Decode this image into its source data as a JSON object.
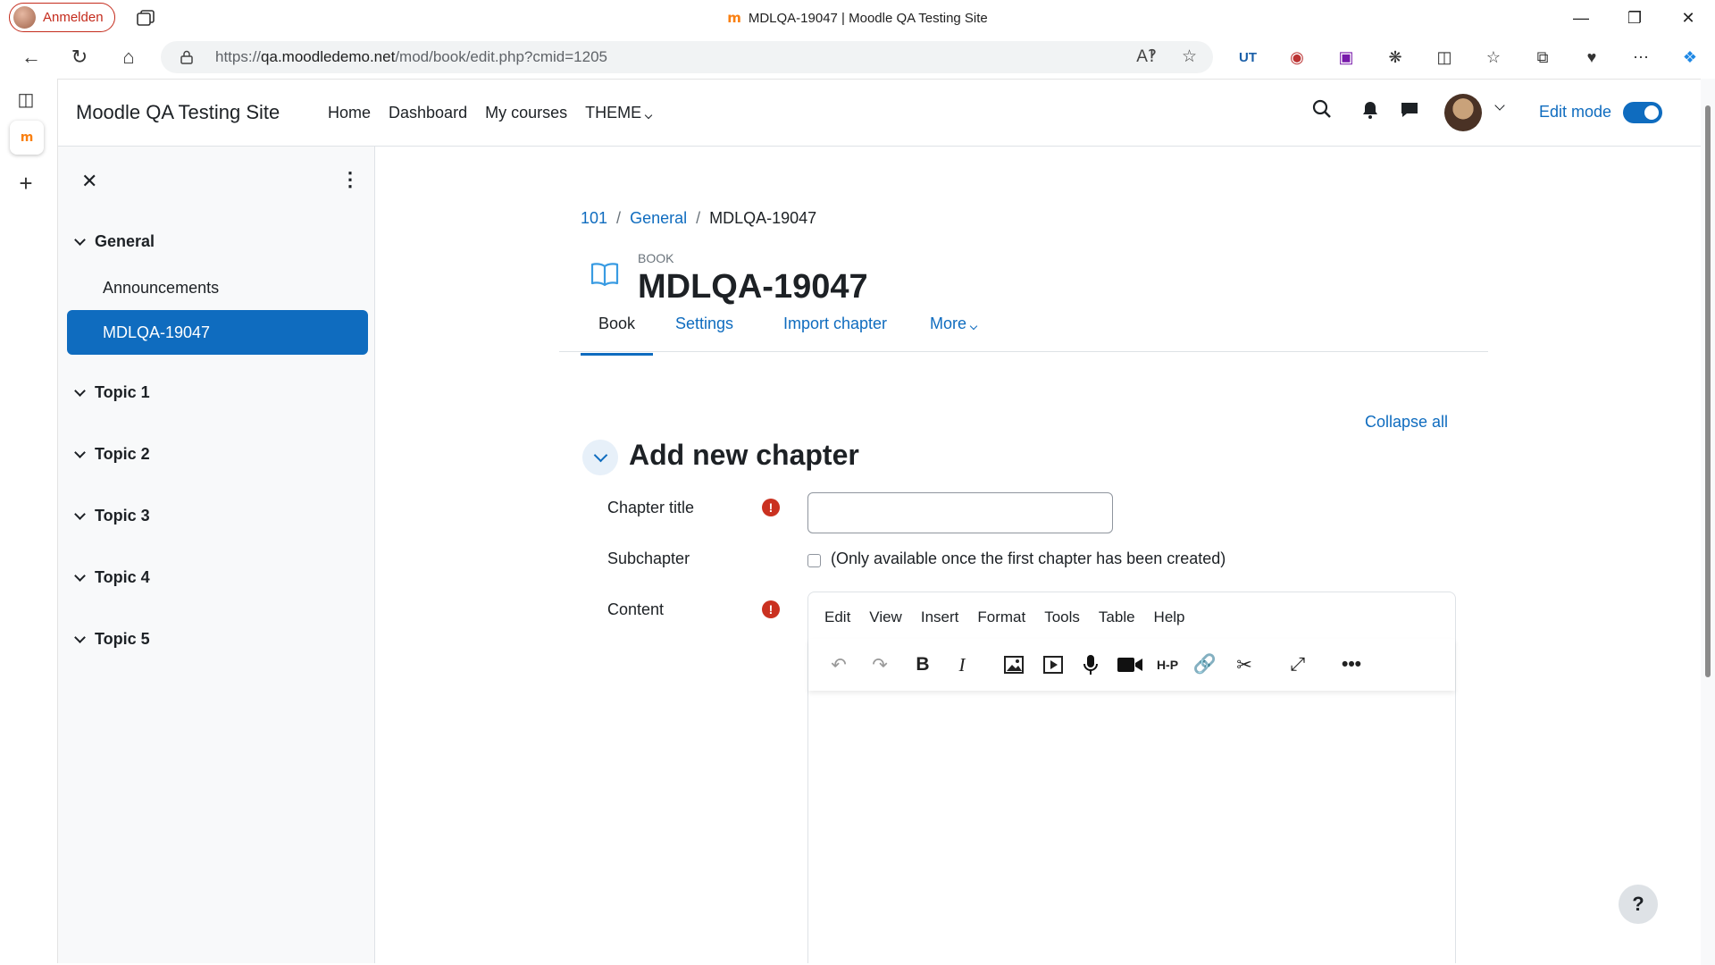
{
  "browser": {
    "profile_label": "Anmelden",
    "window_title": "MDLQA-19047 | Moodle QA Testing Site",
    "url_prefix": "https://",
    "url_host": "qa.moodledemo.net",
    "url_path": "/mod/book/edit.php?cmid=1205",
    "ext_label_ut": "UT"
  },
  "navbar": {
    "site_name": "Moodle QA Testing Site",
    "links": [
      "Home",
      "Dashboard",
      "My courses",
      "THEME"
    ],
    "edit_mode_label": "Edit mode",
    "edit_mode_on": true
  },
  "course_index": {
    "sections": [
      {
        "label": "General",
        "items": [
          "Announcements",
          "MDLQA-19047"
        ]
      },
      {
        "label": "Topic 1"
      },
      {
        "label": "Topic 2"
      },
      {
        "label": "Topic 3"
      },
      {
        "label": "Topic 4"
      },
      {
        "label": "Topic 5"
      }
    ]
  },
  "breadcrumb": [
    "101",
    "General",
    "MDLQA-19047"
  ],
  "page": {
    "module_type": "BOOK",
    "title": "MDLQA-19047",
    "tabs": [
      "Book",
      "Settings",
      "Import chapter",
      "More"
    ],
    "collapse_all": "Collapse all",
    "section_title": "Add new chapter"
  },
  "form": {
    "chapter_title_label": "Chapter title",
    "chapter_title_value": "",
    "subchapter_label": "Subchapter",
    "subchapter_note": "(Only available once the first chapter has been created)",
    "content_label": "Content"
  },
  "editor": {
    "menu": [
      "Edit",
      "View",
      "Insert",
      "Format",
      "Tools",
      "Table",
      "Help"
    ]
  },
  "colors": {
    "brand": "#0f6cbf",
    "required": "#ca3120"
  }
}
